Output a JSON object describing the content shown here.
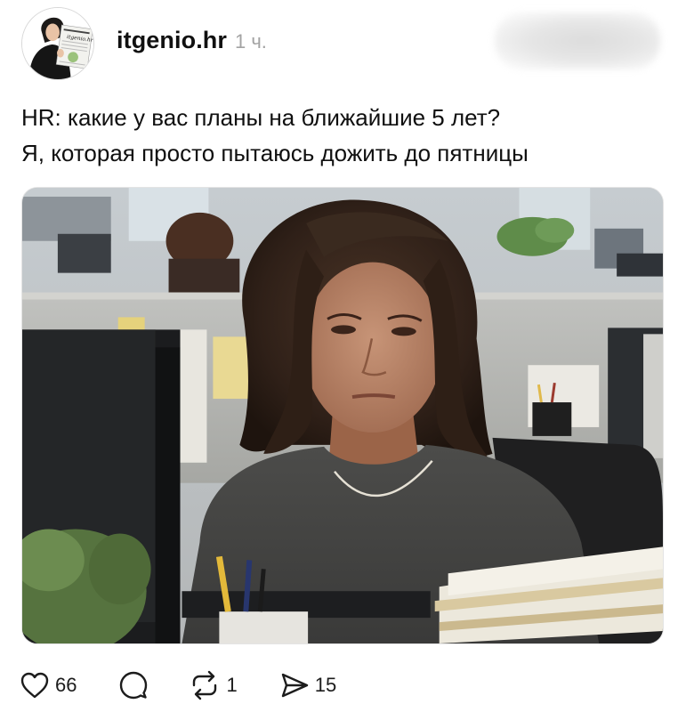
{
  "post": {
    "username": "itgenio.hr",
    "time": "1 ч.",
    "avatar_icon": "profile-avatar",
    "avatar_newspaper_label": "itgenio.hr",
    "text_lines": [
      "HR: какие у вас планы на ближайшие 5 лет?",
      "Я, которая просто пытаюсь дожить до пятницы"
    ],
    "image": {
      "description_icon": "office-photo"
    }
  },
  "actions": {
    "like": {
      "icon": "heart-icon",
      "count": "66"
    },
    "reply": {
      "icon": "comment-icon",
      "count": ""
    },
    "repost": {
      "icon": "repost-icon",
      "count": "1"
    },
    "share": {
      "icon": "send-icon",
      "count": "15"
    }
  },
  "colors": {
    "text": "#101010",
    "muted": "#a3a3a3",
    "background": "#ffffff"
  }
}
